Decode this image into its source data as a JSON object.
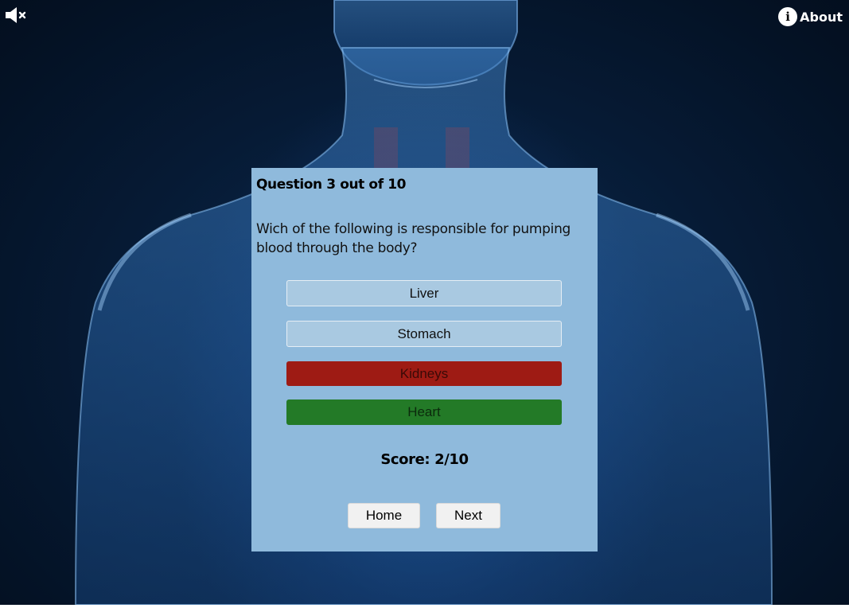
{
  "header": {
    "mute_icon": "speaker-muted-icon",
    "about_icon": "info-icon",
    "about_label": "About"
  },
  "quiz": {
    "question_number": "Question 3 out of 10",
    "question_text": "Wich of the following is responsible for pumping blood through the body?",
    "answers": [
      {
        "label": "Liver",
        "state": "neutral"
      },
      {
        "label": "Stomach",
        "state": "neutral"
      },
      {
        "label": "Kidneys",
        "state": "wrong"
      },
      {
        "label": "Heart",
        "state": "correct"
      }
    ],
    "score": "Score: 2/10",
    "home_label": "Home",
    "next_label": "Next"
  },
  "colors": {
    "panel": "#8fbadc",
    "answer_neutral": "#a9c9e1",
    "answer_wrong": "#9e1b14",
    "answer_correct": "#237a27"
  }
}
